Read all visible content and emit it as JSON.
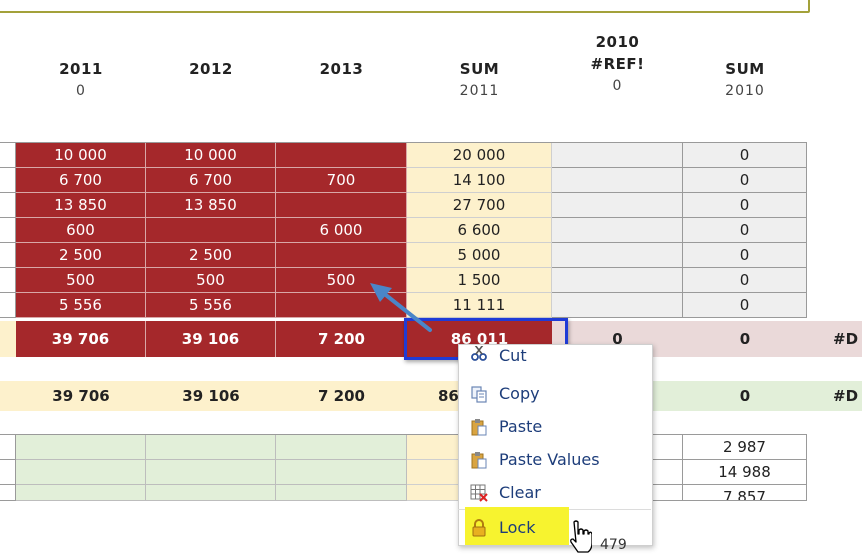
{
  "headers": [
    {
      "top": "",
      "main": "2011",
      "sub": "0"
    },
    {
      "top": "",
      "main": "2012",
      "sub": ""
    },
    {
      "top": "",
      "main": "2013",
      "sub": ""
    },
    {
      "top": "",
      "main": "SUM",
      "sub": "2011"
    },
    {
      "top": "2010",
      "main": "#REF!",
      "sub": "0"
    },
    {
      "top": "",
      "main": "SUM",
      "sub": "2010"
    }
  ],
  "rows": [
    {
      "c2011": "10 000",
      "c2012": "10 000",
      "c2013": "",
      "sum2011": "20 000",
      "ref": "",
      "sum2010": "0"
    },
    {
      "c2011": "6 700",
      "c2012": "6 700",
      "c2013": "700",
      "sum2011": "14 100",
      "ref": "",
      "sum2010": "0"
    },
    {
      "c2011": "13 850",
      "c2012": "13 850",
      "c2013": "",
      "sum2011": "27 700",
      "ref": "",
      "sum2010": "0"
    },
    {
      "c2011": "600",
      "c2012": "",
      "c2013": "6 000",
      "sum2011": "6 600",
      "ref": "",
      "sum2010": "0"
    },
    {
      "c2011": "2 500",
      "c2012": "2 500",
      "c2013": "",
      "sum2011": "5 000",
      "ref": "",
      "sum2010": "0"
    },
    {
      "c2011": "500",
      "c2012": "500",
      "c2013": "500",
      "sum2011": "1 500",
      "ref": "",
      "sum2010": "0"
    },
    {
      "c2011": "5 556",
      "c2012": "5 556",
      "c2013": "",
      "sum2011": "11 111",
      "ref": "",
      "sum2010": "0"
    }
  ],
  "total_row": {
    "c2011": "39 706",
    "c2012": "39 106",
    "c2013": "7 200",
    "sum2011": "86 011",
    "ref": "0",
    "sum2010": "0",
    "extra": "#D"
  },
  "second_total_row": {
    "c2011": "39 706",
    "c2012": "39 106",
    "c2013": "7 200",
    "sum2011": "86",
    "sum2010": "0",
    "extra": "#D"
  },
  "lower_rows": [
    {
      "sum2010": "2 987"
    },
    {
      "sum2010": "14 988"
    },
    {
      "sum2010": "7 857"
    }
  ],
  "partial_value": "479",
  "context_menu": {
    "items": [
      {
        "label": "Cut",
        "icon": "scissors-icon"
      },
      {
        "label": "Copy",
        "icon": "copy-icon"
      },
      {
        "label": "Paste",
        "icon": "paste-icon"
      },
      {
        "label": "Paste Values",
        "icon": "paste-values-icon"
      },
      {
        "label": "Clear",
        "icon": "clear-icon"
      },
      {
        "label": "Lock",
        "icon": "lock-icon"
      }
    ]
  },
  "colors": {
    "red": "#a5282b",
    "yellow": "#fdf1cc",
    "highlight": "#f7f32f",
    "selection": "#1f3bd6",
    "arrow": "#4a86c8"
  }
}
